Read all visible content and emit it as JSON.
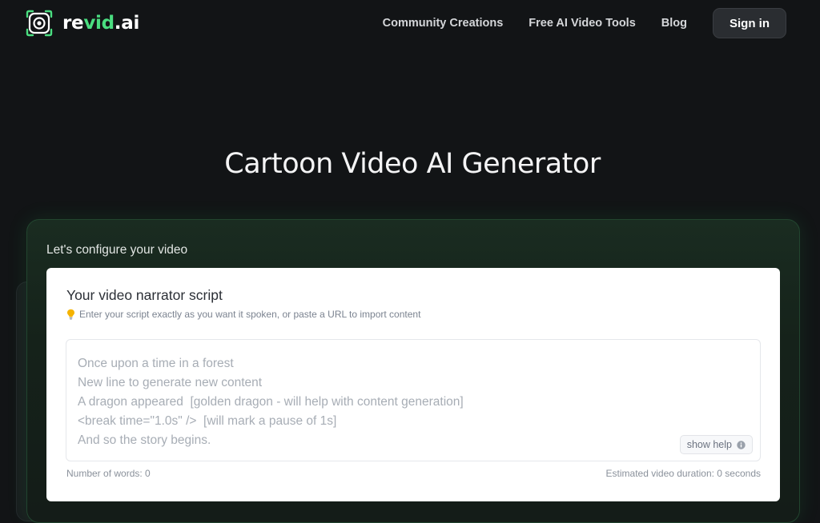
{
  "header": {
    "logo": {
      "text_a": "re",
      "text_b": "vid",
      "text_c": ".ai",
      "icon": "camera-logo-icon"
    },
    "nav": [
      {
        "label": "Community Creations"
      },
      {
        "label": "Free AI Video Tools"
      },
      {
        "label": "Blog"
      }
    ],
    "signin_label": "Sign in"
  },
  "hero": {
    "title": "Cartoon Video AI Generator"
  },
  "config": {
    "heading": "Let's configure your video",
    "card": {
      "title": "Your video narrator script",
      "hint": "Enter your script exactly as you want it spoken, or paste a URL to import content",
      "hint_icon": "lightbulb-icon",
      "placeholder_lines": [
        "Once upon a time in a forest",
        "New line to generate new content",
        "A dragon appeared  [golden dragon - will help with content generation]",
        "<break time=\"1.0s\" />  [will mark a pause of 1s]",
        "And so the story begins."
      ],
      "show_help_label": "show help",
      "show_help_icon": "info-icon",
      "word_count": "Number of words: 0",
      "duration": "Estimated video duration: 0 seconds"
    }
  },
  "colors": {
    "background": "#121416",
    "accent": "#4ade80",
    "panel_border": "#22452f",
    "card": "#ffffff"
  }
}
